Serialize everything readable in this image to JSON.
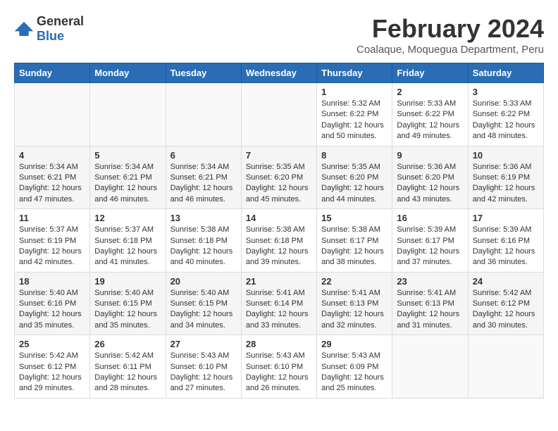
{
  "header": {
    "logo_general": "General",
    "logo_blue": "Blue",
    "month_title": "February 2024",
    "subtitle": "Coalaque, Moquegua Department, Peru"
  },
  "days_of_week": [
    "Sunday",
    "Monday",
    "Tuesday",
    "Wednesday",
    "Thursday",
    "Friday",
    "Saturday"
  ],
  "weeks": [
    [
      {
        "day": "",
        "info": ""
      },
      {
        "day": "",
        "info": ""
      },
      {
        "day": "",
        "info": ""
      },
      {
        "day": "",
        "info": ""
      },
      {
        "day": "1",
        "info": "Sunrise: 5:32 AM\nSunset: 6:22 PM\nDaylight: 12 hours\nand 50 minutes."
      },
      {
        "day": "2",
        "info": "Sunrise: 5:33 AM\nSunset: 6:22 PM\nDaylight: 12 hours\nand 49 minutes."
      },
      {
        "day": "3",
        "info": "Sunrise: 5:33 AM\nSunset: 6:22 PM\nDaylight: 12 hours\nand 48 minutes."
      }
    ],
    [
      {
        "day": "4",
        "info": "Sunrise: 5:34 AM\nSunset: 6:21 PM\nDaylight: 12 hours\nand 47 minutes."
      },
      {
        "day": "5",
        "info": "Sunrise: 5:34 AM\nSunset: 6:21 PM\nDaylight: 12 hours\nand 46 minutes."
      },
      {
        "day": "6",
        "info": "Sunrise: 5:34 AM\nSunset: 6:21 PM\nDaylight: 12 hours\nand 46 minutes."
      },
      {
        "day": "7",
        "info": "Sunrise: 5:35 AM\nSunset: 6:20 PM\nDaylight: 12 hours\nand 45 minutes."
      },
      {
        "day": "8",
        "info": "Sunrise: 5:35 AM\nSunset: 6:20 PM\nDaylight: 12 hours\nand 44 minutes."
      },
      {
        "day": "9",
        "info": "Sunrise: 5:36 AM\nSunset: 6:20 PM\nDaylight: 12 hours\nand 43 minutes."
      },
      {
        "day": "10",
        "info": "Sunrise: 5:36 AM\nSunset: 6:19 PM\nDaylight: 12 hours\nand 42 minutes."
      }
    ],
    [
      {
        "day": "11",
        "info": "Sunrise: 5:37 AM\nSunset: 6:19 PM\nDaylight: 12 hours\nand 42 minutes."
      },
      {
        "day": "12",
        "info": "Sunrise: 5:37 AM\nSunset: 6:18 PM\nDaylight: 12 hours\nand 41 minutes."
      },
      {
        "day": "13",
        "info": "Sunrise: 5:38 AM\nSunset: 6:18 PM\nDaylight: 12 hours\nand 40 minutes."
      },
      {
        "day": "14",
        "info": "Sunrise: 5:38 AM\nSunset: 6:18 PM\nDaylight: 12 hours\nand 39 minutes."
      },
      {
        "day": "15",
        "info": "Sunrise: 5:38 AM\nSunset: 6:17 PM\nDaylight: 12 hours\nand 38 minutes."
      },
      {
        "day": "16",
        "info": "Sunrise: 5:39 AM\nSunset: 6:17 PM\nDaylight: 12 hours\nand 37 minutes."
      },
      {
        "day": "17",
        "info": "Sunrise: 5:39 AM\nSunset: 6:16 PM\nDaylight: 12 hours\nand 36 minutes."
      }
    ],
    [
      {
        "day": "18",
        "info": "Sunrise: 5:40 AM\nSunset: 6:16 PM\nDaylight: 12 hours\nand 35 minutes."
      },
      {
        "day": "19",
        "info": "Sunrise: 5:40 AM\nSunset: 6:15 PM\nDaylight: 12 hours\nand 35 minutes."
      },
      {
        "day": "20",
        "info": "Sunrise: 5:40 AM\nSunset: 6:15 PM\nDaylight: 12 hours\nand 34 minutes."
      },
      {
        "day": "21",
        "info": "Sunrise: 5:41 AM\nSunset: 6:14 PM\nDaylight: 12 hours\nand 33 minutes."
      },
      {
        "day": "22",
        "info": "Sunrise: 5:41 AM\nSunset: 6:13 PM\nDaylight: 12 hours\nand 32 minutes."
      },
      {
        "day": "23",
        "info": "Sunrise: 5:41 AM\nSunset: 6:13 PM\nDaylight: 12 hours\nand 31 minutes."
      },
      {
        "day": "24",
        "info": "Sunrise: 5:42 AM\nSunset: 6:12 PM\nDaylight: 12 hours\nand 30 minutes."
      }
    ],
    [
      {
        "day": "25",
        "info": "Sunrise: 5:42 AM\nSunset: 6:12 PM\nDaylight: 12 hours\nand 29 minutes."
      },
      {
        "day": "26",
        "info": "Sunrise: 5:42 AM\nSunset: 6:11 PM\nDaylight: 12 hours\nand 28 minutes."
      },
      {
        "day": "27",
        "info": "Sunrise: 5:43 AM\nSunset: 6:10 PM\nDaylight: 12 hours\nand 27 minutes."
      },
      {
        "day": "28",
        "info": "Sunrise: 5:43 AM\nSunset: 6:10 PM\nDaylight: 12 hours\nand 26 minutes."
      },
      {
        "day": "29",
        "info": "Sunrise: 5:43 AM\nSunset: 6:09 PM\nDaylight: 12 hours\nand 25 minutes."
      },
      {
        "day": "",
        "info": ""
      },
      {
        "day": "",
        "info": ""
      }
    ]
  ]
}
